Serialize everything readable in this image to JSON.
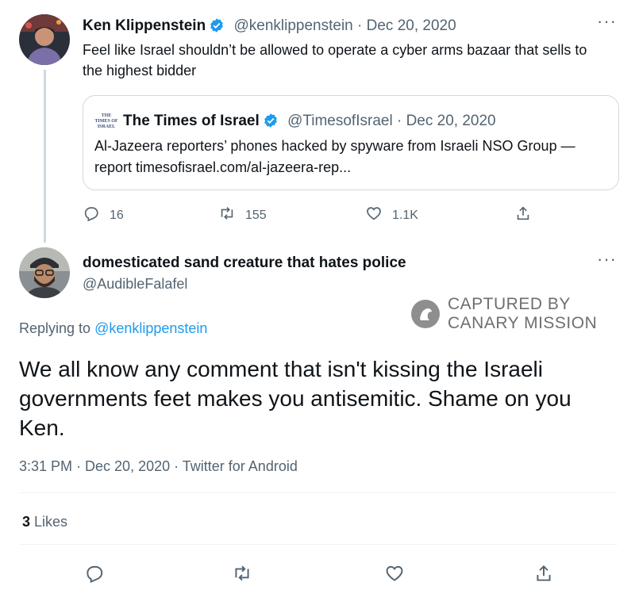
{
  "quoted_tweet": {
    "author_name": "Ken Klippenstein",
    "handle": "@kenklippenstein",
    "date": "Dec 20, 2020",
    "text": "Feel like Israel shouldn’t be allowed to operate a cyber arms bazaar that sells to the highest bidder",
    "embedded": {
      "logo_text": "THE TIMES OF ISRAEL",
      "author_name": "The Times of Israel",
      "handle": "@TimesofIsrael",
      "date": "Dec 20, 2020",
      "text": "Al-Jazeera reporters’ phones hacked by spyware from Israeli NSO Group — report timesofisrael.com/al-jazeera-rep..."
    },
    "stats": {
      "replies": "16",
      "retweets": "155",
      "likes": "1.1K"
    }
  },
  "reply_tweet": {
    "author_name": "domesticated sand creature that hates police",
    "handle": "@AudibleFalafel",
    "replying_to_label": "Replying to",
    "replying_to_handle": "@kenklippenstein",
    "text": "We all know any comment that isn't kissing the Israeli governments feet makes you antisemitic. Shame on you Ken.",
    "timestamp": "3:31 PM · Dec 20, 2020 · Twitter for Android",
    "likes_count": "3",
    "likes_label": "Likes"
  },
  "watermark": {
    "line1": "CAPTURED BY",
    "line2": "CANARY MISSION"
  },
  "icons": {
    "verified": "verified-badge-icon",
    "reply": "reply-icon",
    "retweet": "retweet-icon",
    "like": "heart-icon",
    "share": "share-icon",
    "more": "more-icon"
  },
  "colors": {
    "accent": "#1d9bf0",
    "text": "#0f1419",
    "muted": "#536471"
  }
}
